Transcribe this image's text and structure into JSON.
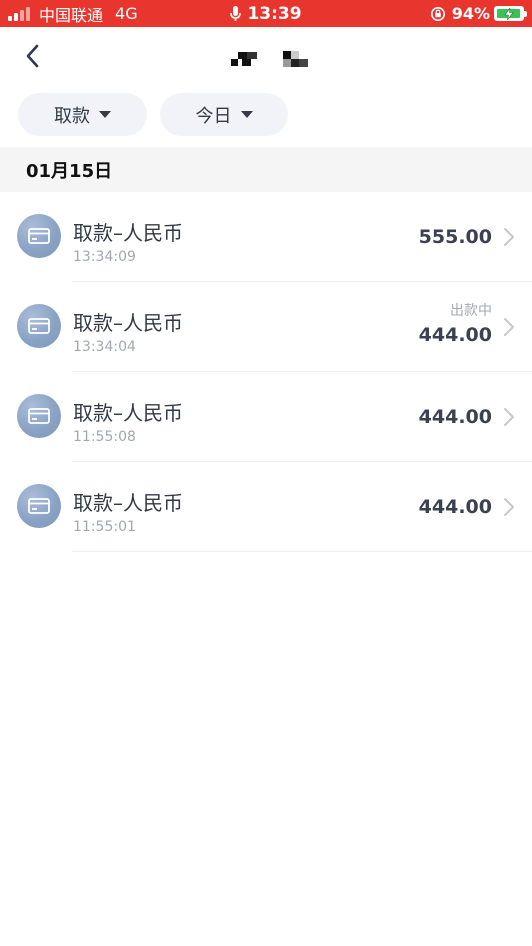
{
  "status_bar": {
    "carrier": "中国联通",
    "network": "4G",
    "time": "13:39",
    "battery_percent": "94%",
    "battery_level": 0.94,
    "icons": [
      "signal-icon",
      "microphone-icon",
      "rotation-lock-icon",
      "battery-charging-icon"
    ]
  },
  "nav": {
    "back_icon": "chevron-left-icon"
  },
  "filters": {
    "type_label": "取款",
    "date_label": "今日"
  },
  "date_header": "01月15日",
  "transactions": [
    {
      "title": "取款–人民币",
      "time": "13:34:09",
      "amount": "555.00",
      "status": ""
    },
    {
      "title": "取款–人民币",
      "time": "13:34:04",
      "amount": "444.00",
      "status": "出款中"
    },
    {
      "title": "取款–人民币",
      "time": "11:55:08",
      "amount": "444.00",
      "status": ""
    },
    {
      "title": "取款–人民币",
      "time": "11:55:01",
      "amount": "444.00",
      "status": ""
    }
  ],
  "colors": {
    "status_bar_bg": "#e8362f",
    "icon_circle": "#8aa3c5",
    "chip_bg": "#f1f3f8",
    "battery_fill": "#3ac25a"
  }
}
